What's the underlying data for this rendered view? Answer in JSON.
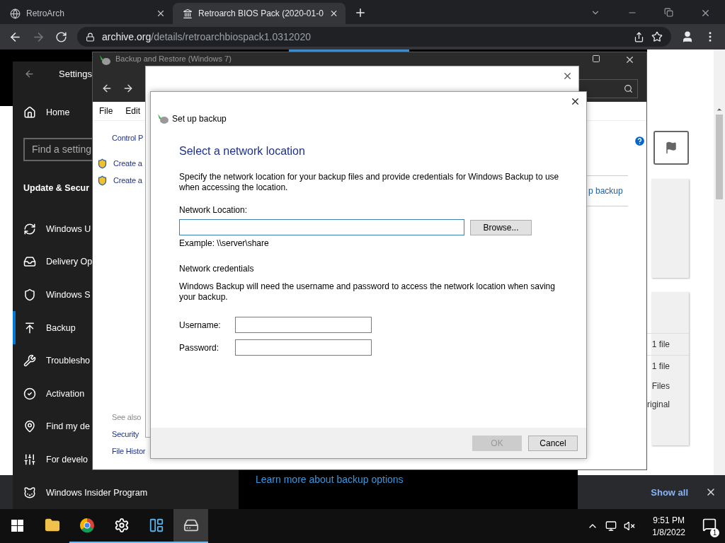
{
  "browser": {
    "tabs": [
      {
        "title": "RetroArch",
        "selected": false
      },
      {
        "title": "Retroarch BIOS Pack (2020-01-0",
        "selected": true
      }
    ],
    "url": {
      "host": "archive.org",
      "path": "/details/retroarchbiospack1.0312020"
    }
  },
  "page": {
    "rows": [
      {
        "text": "1 file",
        "ruled": true
      },
      {
        "text": "1 file",
        "ruled": true
      },
      {
        "text": "Files",
        "ruled": false
      },
      {
        "text": "riginal",
        "ruled": false
      }
    ]
  },
  "downloads_bar": {
    "show_all": "Show all"
  },
  "settings": {
    "title": "Settings",
    "home": "Home",
    "search_placeholder": "Find a setting",
    "section": "Update & Secur",
    "items": [
      {
        "kind": "update",
        "label": "Windows U",
        "selected": false
      },
      {
        "kind": "delivery",
        "label": "Delivery Op",
        "selected": false
      },
      {
        "kind": "security",
        "label": "Windows S",
        "selected": false
      },
      {
        "kind": "backup",
        "label": "Backup",
        "selected": true
      },
      {
        "kind": "troubleshoot",
        "label": "Troublesho",
        "selected": false
      },
      {
        "kind": "activation",
        "label": "Activation",
        "selected": false
      },
      {
        "kind": "find",
        "label": "Find my de",
        "selected": false
      },
      {
        "kind": "developers",
        "label": "For develo",
        "selected": false
      },
      {
        "kind": "insider",
        "label": "Windows Insider Program",
        "selected": false
      }
    ],
    "content_link": "Learn more about backup options"
  },
  "control_panel": {
    "title": "Backup and Restore (Windows 7)",
    "menu": [
      "File",
      "Edit"
    ],
    "breadcrumb": "Control P",
    "tasks": [
      "Create a",
      "Create a"
    ],
    "see_also": "See also",
    "see_also_links": [
      "Security",
      "File Histor"
    ],
    "right_link": "p backup"
  },
  "dialog": {
    "title": "Set up backup",
    "heading": "Select a network location",
    "description": "Specify the network location for your backup files and provide credentials for Windows Backup to use when accessing the location.",
    "location_label": "Network Location:",
    "browse": "Browse...",
    "example": "Example: \\\\server\\share",
    "credentials_heading": "Network credentials",
    "credentials_text": "Windows Backup will need the username and password to access the network location when saving your backup.",
    "username_label": "Username:",
    "password_label": "Password:",
    "buttons": [
      {
        "label": "OK",
        "disabled": true
      },
      {
        "label": "Cancel",
        "disabled": false
      }
    ]
  },
  "taskbar": {
    "apps": [
      {
        "kind": "explorer",
        "running": false,
        "active": false
      },
      {
        "kind": "chrome",
        "running": true,
        "active": false
      },
      {
        "kind": "settings",
        "running": true,
        "active": false
      },
      {
        "kind": "control_panel",
        "running": true,
        "active": false
      },
      {
        "kind": "backup",
        "running": true,
        "active": true
      }
    ],
    "time": "9:51 PM",
    "date": "1/8/2022",
    "notifications": "1"
  }
}
